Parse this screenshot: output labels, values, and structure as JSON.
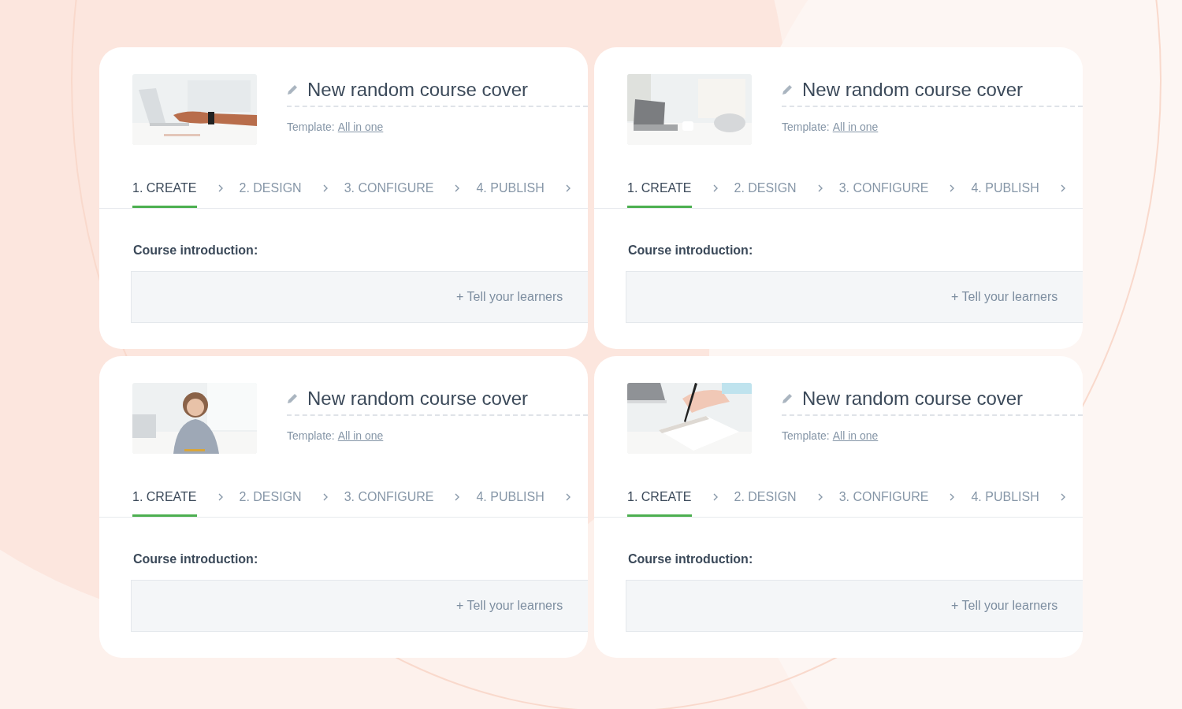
{
  "courses": [
    {
      "title": "New random course cover",
      "template_label": "Template:",
      "template": "All in one",
      "steps": [
        {
          "label": "1. CREATE",
          "selected": true
        },
        {
          "label": "2. DESIGN",
          "selected": false
        },
        {
          "label": "3. CONFIGURE",
          "selected": false
        },
        {
          "label": "4. PUBLISH",
          "selected": false
        }
      ],
      "intro_label": "Course introduction:",
      "intro_placeholder": "+ Tell your learners"
    },
    {
      "title": "New random course cover",
      "template_label": "Template:",
      "template": "All in one",
      "steps": [
        {
          "label": "1. CREATE",
          "selected": true
        },
        {
          "label": "2. DESIGN",
          "selected": false
        },
        {
          "label": "3. CONFIGURE",
          "selected": false
        },
        {
          "label": "4. PUBLISH",
          "selected": false
        }
      ],
      "intro_label": "Course introduction:",
      "intro_placeholder": "+ Tell your learners"
    },
    {
      "title": "New random course cover",
      "template_label": "Template:",
      "template": "All in one",
      "steps": [
        {
          "label": "1. CREATE",
          "selected": true
        },
        {
          "label": "2. DESIGN",
          "selected": false
        },
        {
          "label": "3. CONFIGURE",
          "selected": false
        },
        {
          "label": "4. PUBLISH",
          "selected": false
        }
      ],
      "intro_label": "Course introduction:",
      "intro_placeholder": "+ Tell your learners"
    },
    {
      "title": "New random course cover",
      "template_label": "Template:",
      "template": "All in one",
      "steps": [
        {
          "label": "1. CREATE",
          "selected": true
        },
        {
          "label": "2. DESIGN",
          "selected": false
        },
        {
          "label": "3. CONFIGURE",
          "selected": false
        },
        {
          "label": "4. PUBLISH",
          "selected": false
        }
      ],
      "intro_label": "Course introduction:",
      "intro_placeholder": "+ Tell your learners"
    }
  ]
}
